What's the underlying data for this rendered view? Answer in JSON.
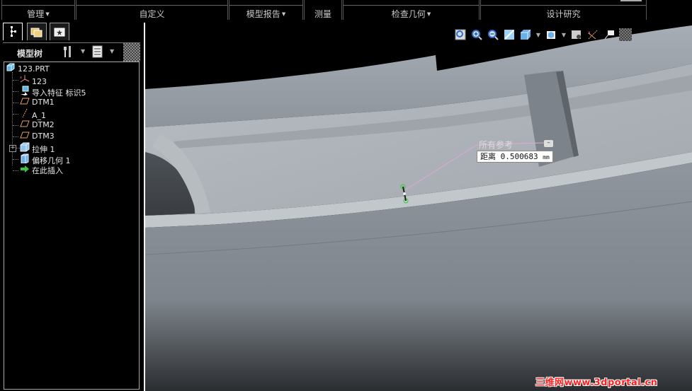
{
  "ribbon": {
    "groups": [
      {
        "label": "管理",
        "has_menu": true
      },
      {
        "label": "自定义",
        "has_menu": false
      },
      {
        "label": "模型报告",
        "has_menu": true
      },
      {
        "label": "测量",
        "has_menu": false
      },
      {
        "label": "检查几何",
        "has_menu": true
      },
      {
        "label": "设计研究",
        "has_menu": false
      }
    ]
  },
  "navigator": {
    "tabs": [
      {
        "icon": "model-tree-icon"
      },
      {
        "icon": "folder-browser-icon"
      },
      {
        "icon": "favorites-icon"
      }
    ],
    "tree_title": "模型树",
    "tree_items": [
      {
        "label": "123.PRT",
        "icon": "part-icon"
      },
      {
        "label": "123",
        "icon": "coordinate-system-icon"
      },
      {
        "label": "导入特征 标识5",
        "icon": "import-feature-icon"
      },
      {
        "label": "DTM1",
        "icon": "datum-plane-icon"
      },
      {
        "label": "A_1",
        "icon": "datum-axis-icon"
      },
      {
        "label": "DTM2",
        "icon": "datum-plane-icon"
      },
      {
        "label": "DTM3",
        "icon": "datum-plane-icon"
      },
      {
        "label": "拉伸 1",
        "icon": "extrude-icon"
      },
      {
        "label": "偏移几何 1",
        "icon": "offset-geometry-icon"
      },
      {
        "label": "在此插入",
        "icon": "insert-here-arrow-icon"
      }
    ]
  },
  "viewport": {
    "measure_ref_label": "所有参考",
    "measure_result_label": "距离",
    "measure_value": "0.500683",
    "measure_unit": "mm",
    "model_color": "#9aa1a8"
  },
  "watermark": "三维网www.3dportal.cn"
}
